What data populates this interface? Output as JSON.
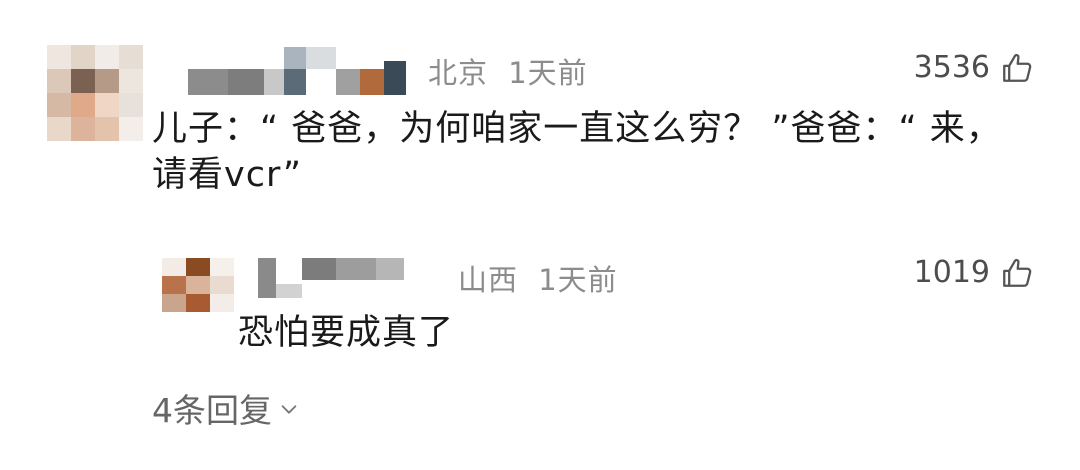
{
  "colors": {
    "text_primary": "#1a1a1a",
    "text_meta": "#8c8c8c",
    "count": "#4d4d4d",
    "icon": "#555555",
    "reply_link": "#666666"
  },
  "comment": {
    "location": "北京",
    "time": "1天前",
    "like_count": "3536",
    "like_icon": "thumb-up-icon",
    "text_line1": "儿子：“ 爸爸，为何咱家一直这么穷？ ”爸爸：“ 来，",
    "text_line2": "请看vcr”",
    "avatar_pixels": [
      "#efe6df",
      "#e3d4c8",
      "#f1ece7",
      "#e6ddd4",
      "#dcc8b8",
      "#7a6152",
      "#b59a88",
      "#ede6df",
      "#d6b9a4",
      "#e0a98a",
      "#f0d6c4",
      "#e8e1db",
      "#e9d8ca",
      "#dcb49c",
      "#e4c3ad",
      "#f3eeea"
    ],
    "name_pixels": [
      "#8c8c8c",
      "#7d7d7d",
      "#c8c8c8",
      "#a9b4be",
      "#5c6b78",
      "#d9dde0",
      "#a0a0a0",
      "#b06a3c",
      "#3b4a57"
    ]
  },
  "reply": {
    "location": "山西",
    "time": "1天前",
    "like_count": "1019",
    "like_icon": "thumb-up-icon",
    "text": "恐怕要成真了",
    "avatar_pixels": [
      "#f2ebe6",
      "#8a4a22",
      "#f6f0eb",
      "#b8734a",
      "#d9b49a",
      "#eadbd0",
      "#c9a58d",
      "#a85b32",
      "#f3ece7"
    ],
    "name_pixels": [
      "#8a8a8a",
      "#d2d2d2",
      "#7c7c7c",
      "#9d9d9d",
      "#b6b6b6"
    ]
  },
  "footer": {
    "more_replies_label": "4条回复",
    "chevron_icon": "chevron-down-icon"
  }
}
